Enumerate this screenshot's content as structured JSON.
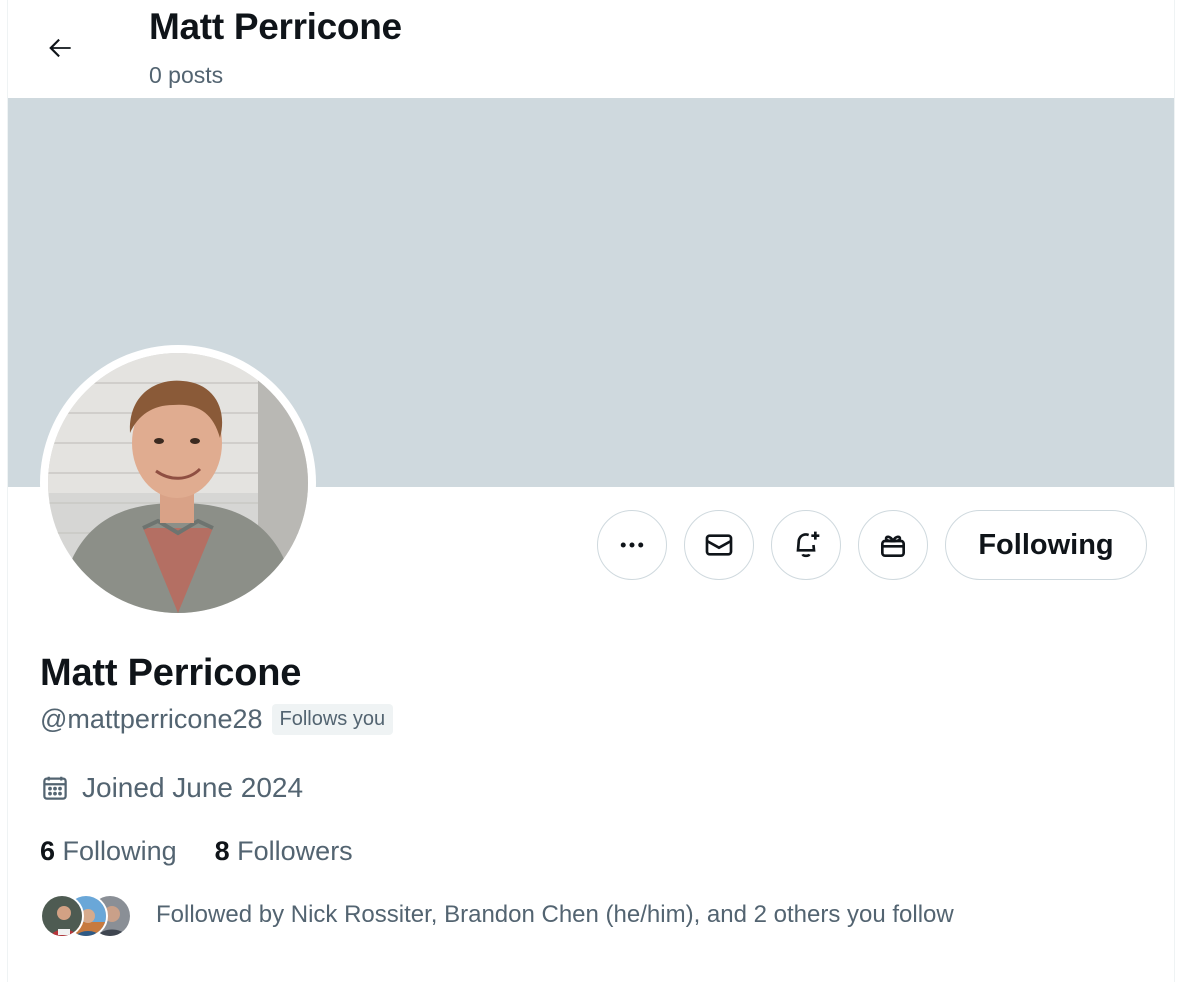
{
  "header": {
    "title": "Matt Perricone",
    "post_count": "0 posts",
    "back_icon": "arrow-left-icon"
  },
  "banner": {
    "color": "#cfd9de"
  },
  "actions": {
    "more_icon": "ellipsis-icon",
    "message_icon": "envelope-icon",
    "notify_icon": "bell-plus-icon",
    "gift_icon": "gift-icon",
    "follow_label": "Following"
  },
  "profile": {
    "name": "Matt Perricone",
    "handle": "@mattperricone28",
    "follows_you_badge": "Follows you",
    "joined": "Joined June 2024",
    "calendar_icon": "calendar-icon",
    "following_count": "6",
    "following_label": "Following",
    "followers_count": "8",
    "followers_label": "Followers",
    "followed_by": "Followed by Nick Rossiter, Brandon Chen (he/him), and 2 others you follow"
  },
  "colors": {
    "text_primary": "#0f1419",
    "text_secondary": "#536471",
    "border": "#cfd9de",
    "badge_bg": "#eff3f4"
  }
}
